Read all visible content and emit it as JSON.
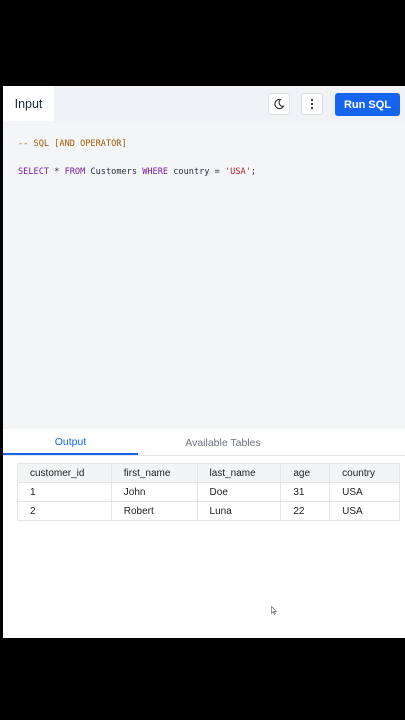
{
  "header": {
    "input_tab": "Input",
    "theme_icon": "moon-icon",
    "menu_icon": "vertical-dots-icon",
    "run_label": "Run SQL"
  },
  "editor": {
    "lines": [
      [
        {
          "t": "-- SQL [AND OPERATOR]",
          "c": "c-comment"
        }
      ],
      [
        {
          "t": "SELECT",
          "c": "c-kw"
        },
        {
          "t": " * ",
          "c": "c-plain"
        },
        {
          "t": "FROM",
          "c": "c-kw"
        },
        {
          "t": " Customers ",
          "c": "c-plain"
        },
        {
          "t": "WHERE",
          "c": "c-kw"
        },
        {
          "t": " country = ",
          "c": "c-plain"
        },
        {
          "t": "'USA'",
          "c": "c-str"
        },
        {
          "t": ";",
          "c": "c-plain"
        }
      ]
    ]
  },
  "output": {
    "tabs": {
      "output": "Output",
      "tables": "Available Tables"
    },
    "columns": [
      "customer_id",
      "first_name",
      "last_name",
      "age",
      "country"
    ],
    "rows": [
      [
        "1",
        "John",
        "Doe",
        "31",
        "USA"
      ],
      [
        "2",
        "Robert",
        "Luna",
        "22",
        "USA"
      ]
    ]
  },
  "colors": {
    "accent": "#1565f0",
    "editor_bg": "#f4f5f7"
  }
}
